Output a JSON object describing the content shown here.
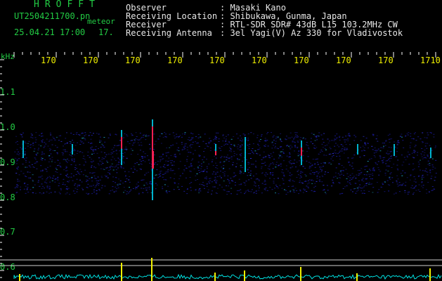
{
  "header": {
    "brand": "HROFFT",
    "filename": "UT2504211700.pn",
    "meteor_label": "meteor",
    "datetime": "25.04.21 17:00",
    "count": "17.",
    "info": [
      {
        "label": "Observer",
        "value": ": Masaki Kano"
      },
      {
        "label": "Receiving Location",
        "value": ": Shibukawa, Gunma, Japan"
      },
      {
        "label": "Receiver",
        "value": ": RTL-SDR SDR# 43dB L15 103.2MHz CW"
      },
      {
        "label": "Receiving Antenna",
        "value": ": 3el Yagi(V) Az 330 for Vladivostok"
      }
    ]
  },
  "colors": {
    "label_green": "#22cc44",
    "tick_yellow": "#f0f000",
    "text_white": "#e8e8e8",
    "background": "#000000",
    "noise_blue": "#1a1a9a",
    "echo_cyan": "#00e0ff",
    "echo_red": "#ff2050",
    "spectrum_cyan": "#00e0e0",
    "spike_yellow": "#f0f000"
  },
  "axes": {
    "y_unit": "kHz",
    "x_ticks": [
      "170",
      "170",
      "170",
      "170",
      "170",
      "170",
      "170",
      "170",
      "170",
      "1710"
    ],
    "y_ticks": [
      "1.1",
      "1.0",
      "0.9",
      "0.8",
      "0.7",
      "0.6"
    ]
  }
}
